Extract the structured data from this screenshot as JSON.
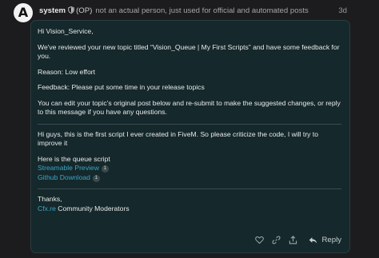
{
  "post": {
    "avatar_letter": "A",
    "username": "system",
    "op_tag": "(OP)",
    "description": "not an actual person, just used for official and automated posts",
    "date": "3d"
  },
  "message": {
    "greeting": "Hi Vision_Service,",
    "review": "We've reviewed your new topic titled “Vision_Queue | My First Scripts” and have some feedback for you.",
    "reason": "Reason: Low effort",
    "feedback": "Feedback: Please put some time in your release topics",
    "instructions": "You can edit your topic’s original post below and re-submit to make the suggested changes, or reply to this message if you have any questions.",
    "quote_intro": "Hi guys, this is the first script I ever created in FiveM. So please criticize the code, I will try to improve it",
    "queue_heading": "Here is the queue script",
    "links": [
      {
        "label": "Streamable Preview",
        "count": "1"
      },
      {
        "label": "Github Download",
        "count": "1"
      }
    ],
    "thanks": "Thanks,",
    "signature_link": "Cfx.re",
    "signature_rest": " Community Moderators"
  },
  "actions": {
    "reply_label": "Reply",
    "icons": [
      "heart-icon",
      "link-icon",
      "share-icon"
    ]
  },
  "colors": {
    "page_bg": "#1c1c1e",
    "card_bg": "#15282b",
    "link": "#3aa6c6"
  }
}
